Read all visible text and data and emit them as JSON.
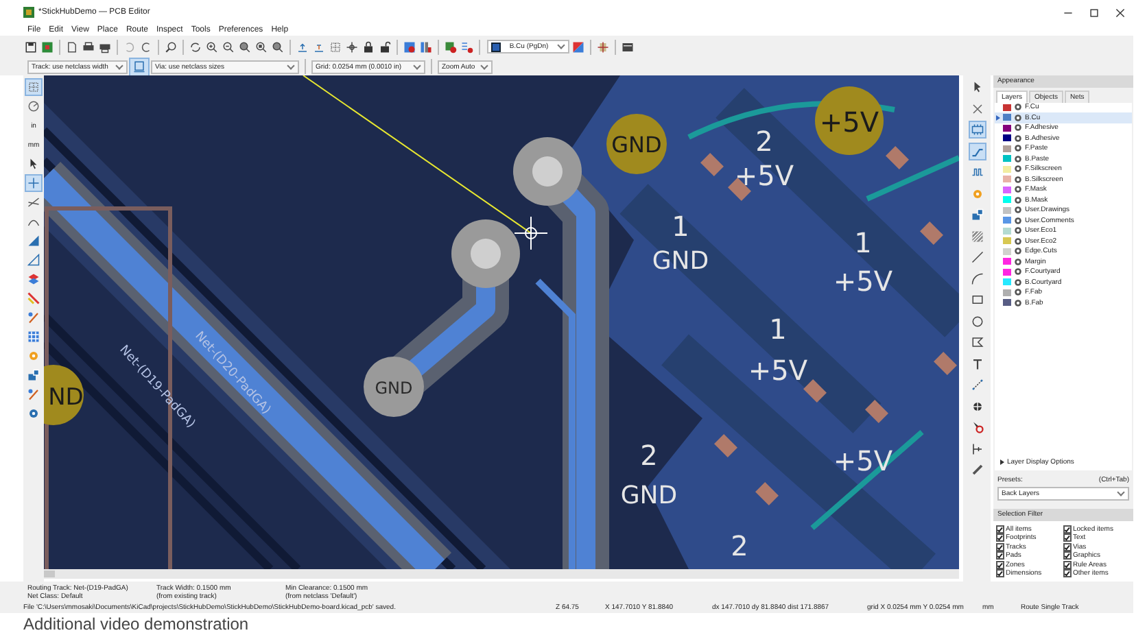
{
  "window": {
    "title": "*StickHubDemo — PCB Editor"
  },
  "menu": [
    "File",
    "Edit",
    "View",
    "Place",
    "Route",
    "Inspect",
    "Tools",
    "Preferences",
    "Help"
  ],
  "toolbar": {
    "layer_select": "B.Cu (PgDn)"
  },
  "options_bar": {
    "track_width": "Track: use netclass width",
    "auto_width_on": true,
    "via_size": "Via: use netclass sizes",
    "grid": "Grid: 0.0254 mm (0.0010 in)",
    "zoom": "Zoom Auto"
  },
  "units": [
    {
      "label": "in",
      "selected": false
    },
    {
      "label": "mm",
      "selected": false
    }
  ],
  "canvas": {
    "pad_labels": [
      {
        "text": "GND",
        "kind": "gold"
      },
      {
        "text": "+5V",
        "kind": "gold"
      },
      {
        "text": "2",
        "kind": "copper"
      },
      {
        "text": "+5V",
        "kind": "copper"
      },
      {
        "text": "1",
        "kind": "copper"
      },
      {
        "text": "GND",
        "kind": "copper"
      },
      {
        "text": "1",
        "kind": "copper"
      },
      {
        "text": "+5V",
        "kind": "copper"
      },
      {
        "text": "1",
        "kind": "copper"
      },
      {
        "text": "+5V",
        "kind": "copper"
      },
      {
        "text": "ND",
        "kind": "gold"
      },
      {
        "text": "GND",
        "kind": "gray"
      },
      {
        "text": "2",
        "kind": "copper"
      },
      {
        "text": "GND",
        "kind": "copper"
      },
      {
        "text": "+5V",
        "kind": "copper"
      },
      {
        "text": "2",
        "kind": "copper"
      }
    ],
    "net_labels": [
      "Net-(D19-PadGA)",
      "Net-(D20-PadGA)"
    ]
  },
  "appearance": {
    "title": "Appearance",
    "tabs": [
      {
        "label": "Layers",
        "selected": true
      },
      {
        "label": "Objects",
        "selected": false
      },
      {
        "label": "Nets",
        "selected": false
      }
    ],
    "layers": [
      {
        "name": "F.Cu",
        "color": "#c83434",
        "selected": false
      },
      {
        "name": "B.Cu",
        "color": "#4d7fc4",
        "selected": true
      },
      {
        "name": "F.Adhesive",
        "color": "#84007c",
        "selected": false
      },
      {
        "name": "B.Adhesive",
        "color": "#000084",
        "selected": false
      },
      {
        "name": "F.Paste",
        "color": "#b0a09a",
        "selected": false
      },
      {
        "name": "B.Paste",
        "color": "#00c2c2",
        "selected": false
      },
      {
        "name": "F.Silkscreen",
        "color": "#f2eda1",
        "selected": false
      },
      {
        "name": "B.Silkscreen",
        "color": "#e8b2a7",
        "selected": false
      },
      {
        "name": "F.Mask",
        "color": "#d864ff",
        "selected": false
      },
      {
        "name": "B.Mask",
        "color": "#02ffee",
        "selected": false
      },
      {
        "name": "User.Drawings",
        "color": "#c2c2c2",
        "selected": false
      },
      {
        "name": "User.Comments",
        "color": "#5996e6",
        "selected": false
      },
      {
        "name": "User.Eco1",
        "color": "#b4dbd2",
        "selected": false
      },
      {
        "name": "User.Eco2",
        "color": "#d8c852",
        "selected": false
      },
      {
        "name": "Edge.Cuts",
        "color": "#d0d2cd",
        "selected": false
      },
      {
        "name": "Margin",
        "color": "#ff26e2",
        "selected": false
      },
      {
        "name": "F.Courtyard",
        "color": "#ff26e2",
        "selected": false
      },
      {
        "name": "B.Courtyard",
        "color": "#26e9ff",
        "selected": false
      },
      {
        "name": "F.Fab",
        "color": "#afafaf",
        "selected": false
      },
      {
        "name": "B.Fab",
        "color": "#585d84",
        "selected": false
      }
    ],
    "display_options": "Layer Display Options",
    "display_options_expanded": false,
    "presets_label": "Presets:",
    "presets_shortcut": "(Ctrl+Tab)",
    "preset": "Back Layers"
  },
  "selection_filter": {
    "title": "Selection Filter",
    "items": [
      {
        "label": "All items",
        "checked": true
      },
      {
        "label": "Locked items",
        "checked": true
      },
      {
        "label": "Footprints",
        "checked": true
      },
      {
        "label": "Text",
        "checked": true
      },
      {
        "label": "Tracks",
        "checked": true
      },
      {
        "label": "Vias",
        "checked": true
      },
      {
        "label": "Pads",
        "checked": true
      },
      {
        "label": "Graphics",
        "checked": true
      },
      {
        "label": "Zones",
        "checked": true
      },
      {
        "label": "Rule Areas",
        "checked": true
      },
      {
        "label": "Dimensions",
        "checked": true
      },
      {
        "label": "Other items",
        "checked": true
      }
    ]
  },
  "status": {
    "info": [
      {
        "line1": "Routing Track: Net-(D19-PadGA)",
        "line2": "Net Class: Default"
      },
      {
        "line1": "Track Width: 0.1500 mm",
        "line2": "(from existing track)"
      },
      {
        "line1": "Min Clearance: 0.1500 mm",
        "line2": "(from netclass 'Default')"
      }
    ],
    "message": "File 'C:\\Users\\mmosaki\\Documents\\KiCad\\projects\\StickHubDemo\\StickHubDemo\\StickHubDemo-board.kicad_pcb' saved.",
    "fields": [
      "Z 64.75",
      "X 147.7010 Y 81.8840",
      "dx 147.7010 dy 81.8840 dist 171.8867",
      "grid X 0.0254 mm Y 0.0254 mm",
      "mm",
      "Route Single Track"
    ]
  },
  "footer": "Additional video demonstration"
}
